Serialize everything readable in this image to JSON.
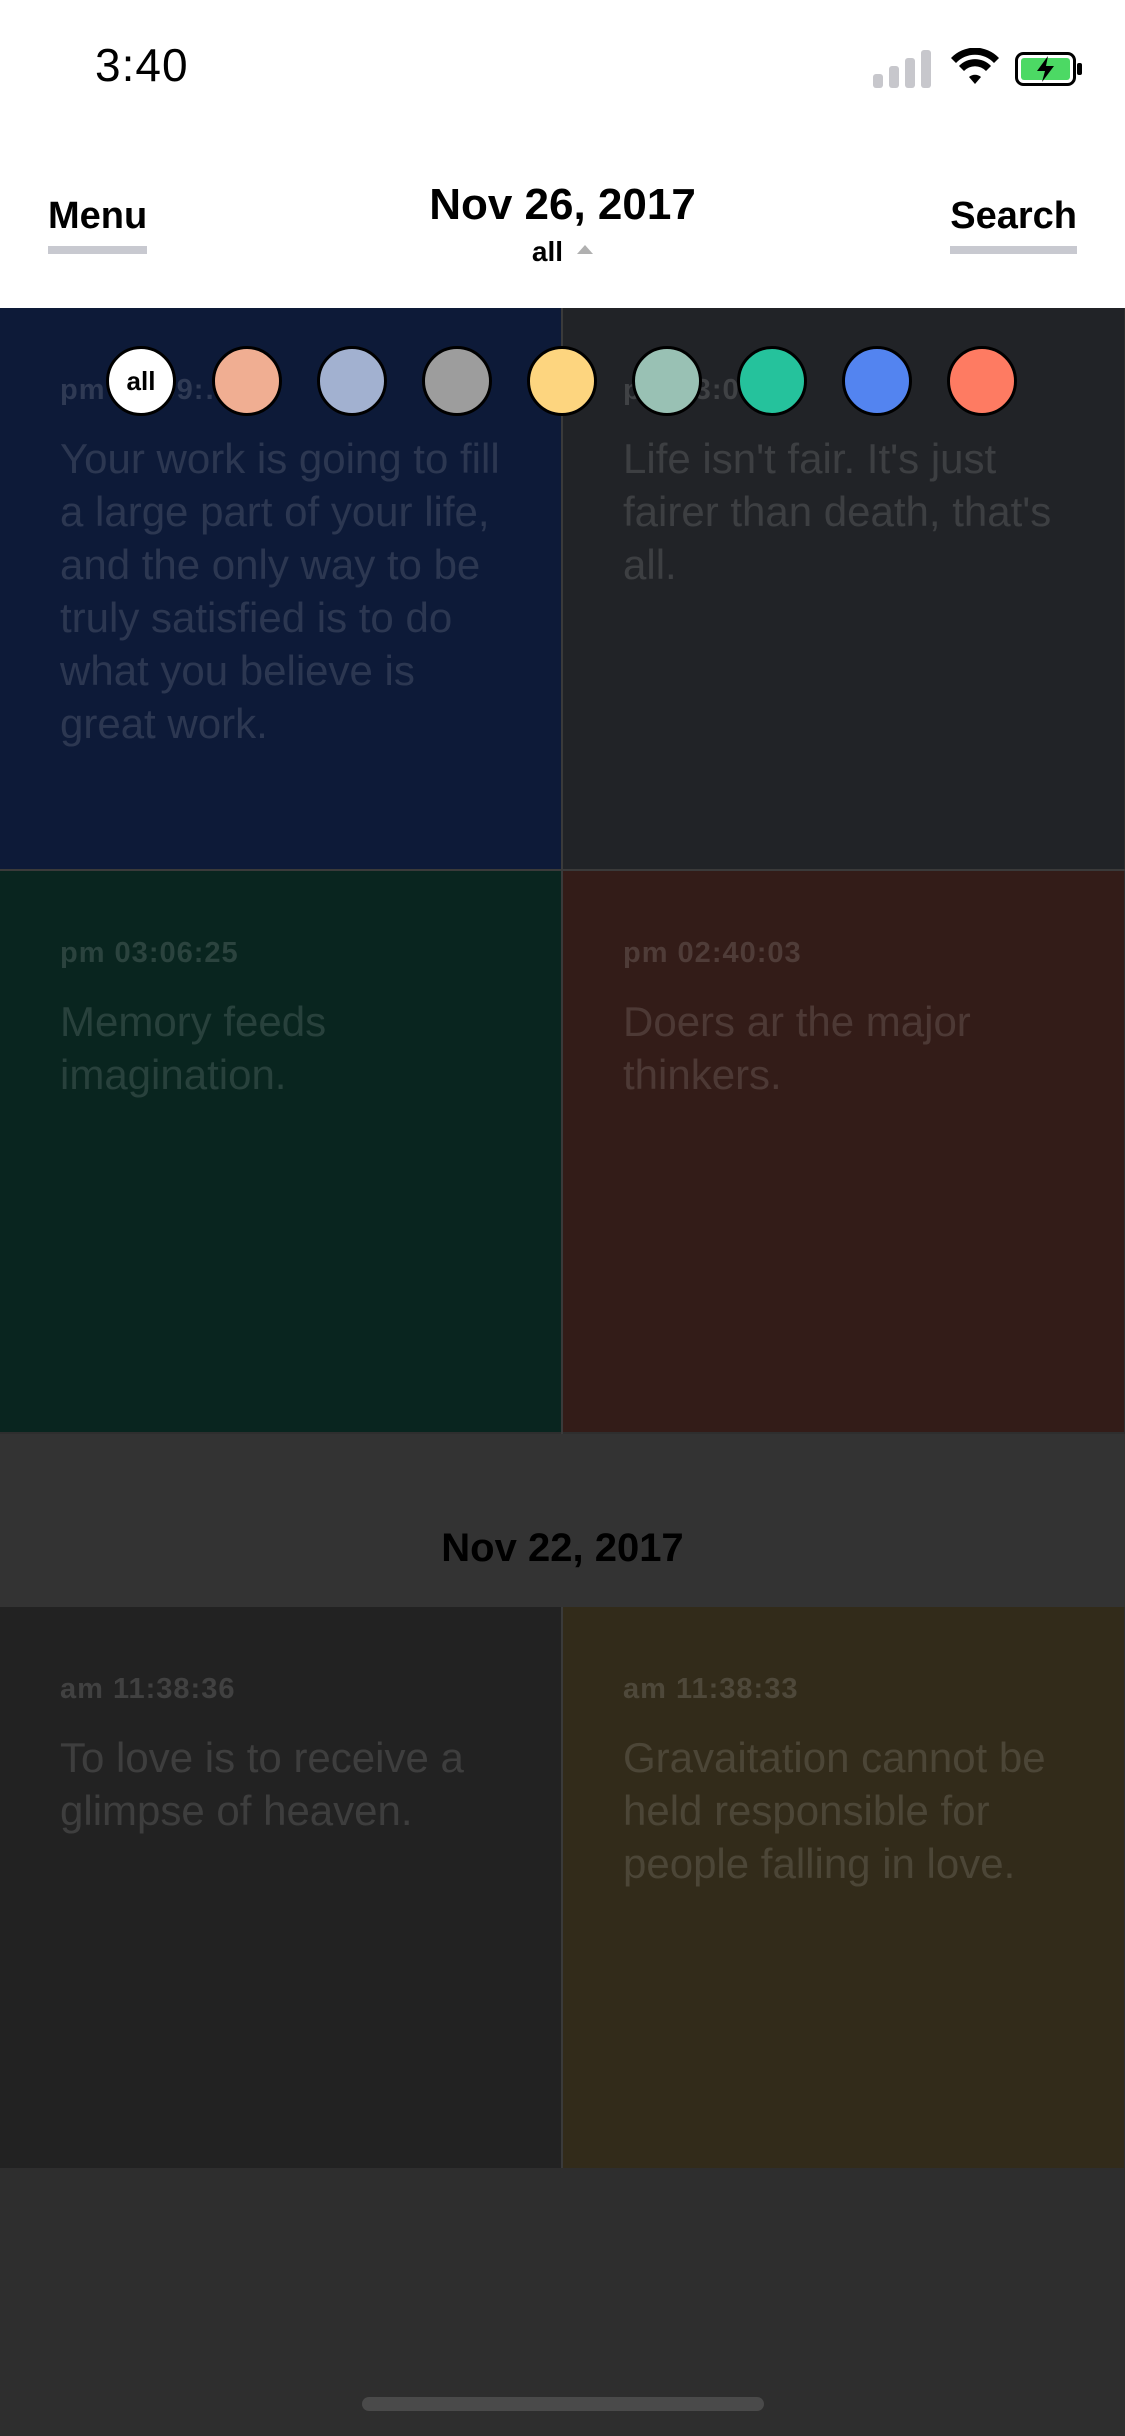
{
  "status": {
    "time": "3:40"
  },
  "header": {
    "menu_label": "Menu",
    "search_label": "Search",
    "date": "Nov 26, 2017",
    "filter": "all"
  },
  "color_filter": {
    "all_label": "all",
    "colors": [
      "#f0ae92",
      "#a2b1d0",
      "#9d9d9d",
      "#fdd57f",
      "#99c1b4",
      "#25c29c",
      "#5384f0",
      "#fe7b62"
    ]
  },
  "sections": [
    {
      "date": "Nov 26, 2017",
      "notes": [
        {
          "time": "pm 03:09:…",
          "text": "Your work is going to fill a large part of your life, and the only way to be truly satisfied is to do what you believe is great work.",
          "color": "#0d1a38"
        },
        {
          "time": "pm 03:0…5",
          "text": "Life isn't fair. It's just fairer than death, that's all.",
          "color": "#212327"
        },
        {
          "time": "pm 03:06:25",
          "text": "Memory feeds imagination.",
          "color": "#09251f"
        },
        {
          "time": "pm 02:40:03",
          "text": "Doers ar the major thinkers.",
          "color": "#331c18"
        }
      ]
    },
    {
      "date": "Nov 22, 2017",
      "notes": [
        {
          "time": "am 11:38:36",
          "text": "To love is to receive a glimpse of heaven.",
          "color": "#222222"
        },
        {
          "time": "am 11:38:33",
          "text": "Gravaitation cannot be held responsible for people falling in love.",
          "color": "#322b1a"
        }
      ]
    }
  ]
}
